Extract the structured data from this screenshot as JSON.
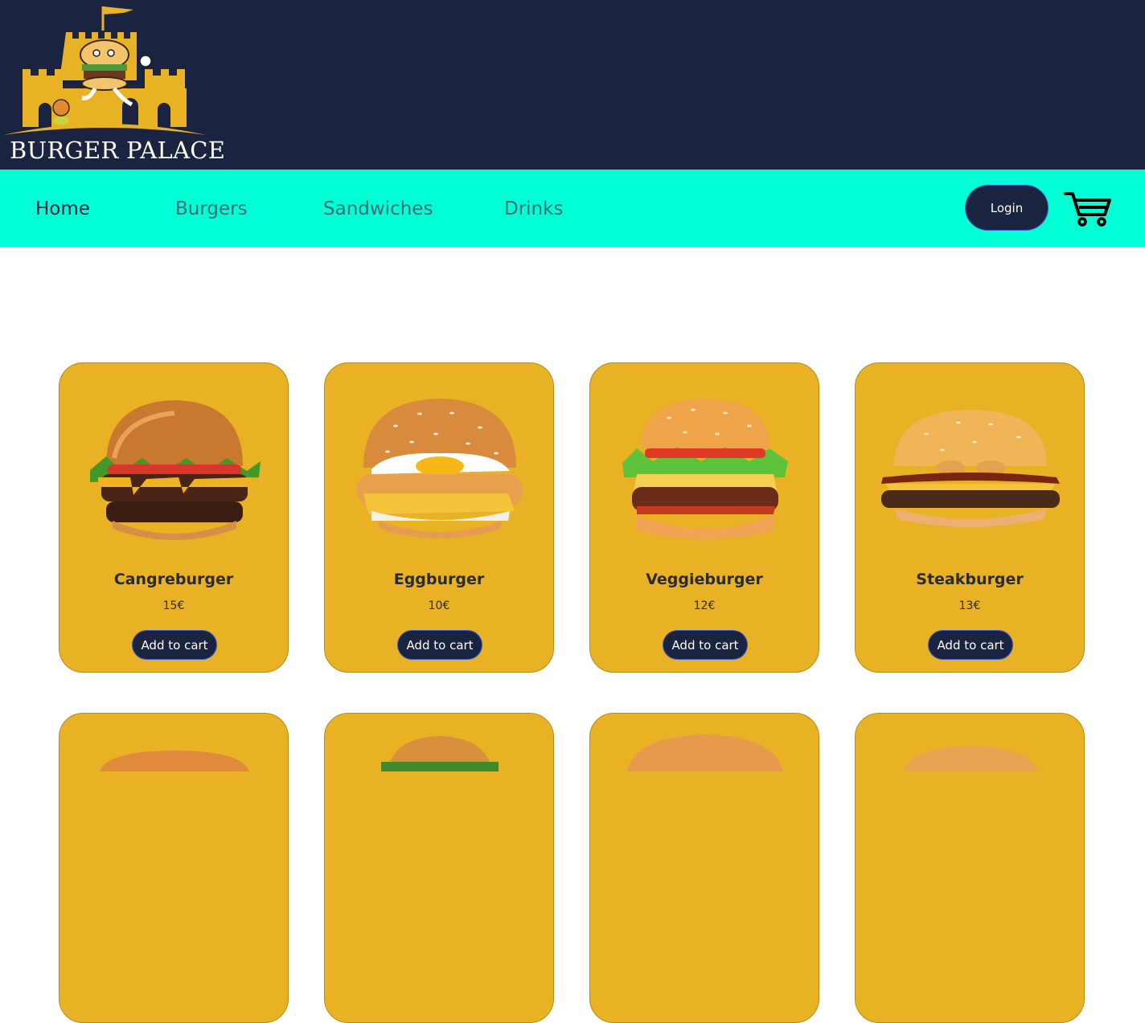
{
  "brand": {
    "name": "BURGER PALACE"
  },
  "nav": {
    "items": [
      {
        "label": "Home",
        "active": true
      },
      {
        "label": "Burgers",
        "active": false
      },
      {
        "label": "Sandwiches",
        "active": false
      },
      {
        "label": "Drinks",
        "active": false
      }
    ],
    "login_label": "Login",
    "cart_icon": "shopping-cart-icon"
  },
  "colors": {
    "header_bg": "#1a233f",
    "navbar_bg": "#00ffd5",
    "card_bg": "#e9b224",
    "button_bg": "#1a233f"
  },
  "products": [
    {
      "name": "Cangreburger",
      "price": "15€",
      "button": "Add to cart"
    },
    {
      "name": "Eggburger",
      "price": "10€",
      "button": "Add to cart"
    },
    {
      "name": "Veggieburger",
      "price": "12€",
      "button": "Add to cart"
    },
    {
      "name": "Steakburger",
      "price": "13€",
      "button": "Add to cart"
    }
  ]
}
